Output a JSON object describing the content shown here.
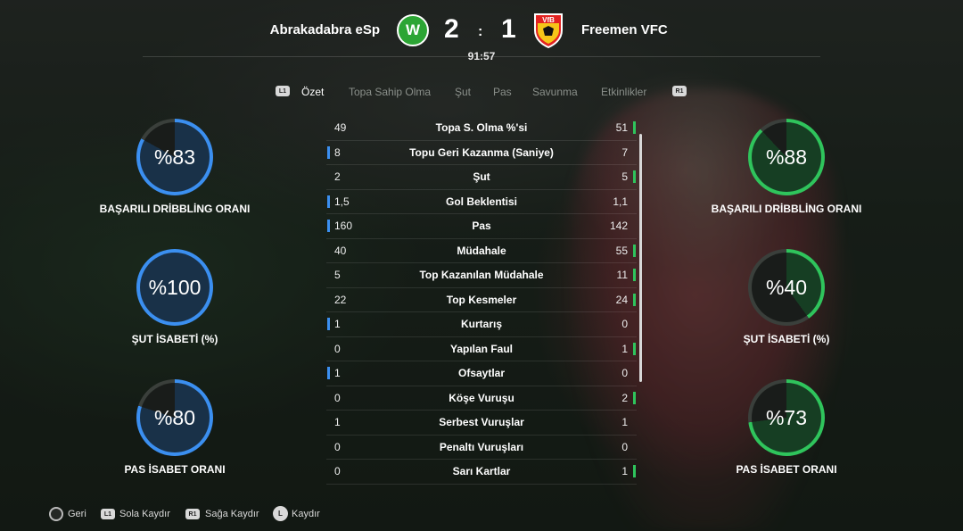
{
  "match": {
    "home_team": "Abrakadabra eSp",
    "away_team": "Freemen VFC",
    "home_score": "2",
    "away_score": "1",
    "separator": ":",
    "clock": "91:57",
    "home_crest_letter": "W",
    "away_crest_text": "VfB"
  },
  "tabs": {
    "left_button": "L1",
    "right_button": "R1",
    "items": [
      "Özet",
      "Topa Sahip Olma",
      "Şut",
      "Pas",
      "Savunma",
      "Etkinlikler"
    ],
    "active_index": 0
  },
  "home_rings": [
    {
      "value": "%83",
      "label": "BAŞARILI DRİBBLİNG ORANI",
      "percent": 83
    },
    {
      "value": "%100",
      "label": "ŞUT İSABETİ (%)",
      "percent": 100
    },
    {
      "value": "%80",
      "label": "PAS İSABET ORANI",
      "percent": 80
    }
  ],
  "away_rings": [
    {
      "value": "%88",
      "label": "BAŞARILI DRİBBLİNG ORANI",
      "percent": 88
    },
    {
      "value": "%40",
      "label": "ŞUT İSABETİ (%)",
      "percent": 40
    },
    {
      "value": "%73",
      "label": "PAS İSABET ORANI",
      "percent": 73
    }
  ],
  "stats": [
    {
      "name": "Topa S. Olma %'si",
      "home": "49",
      "away": "51",
      "leader": "away"
    },
    {
      "name": "Topu Geri Kazanma (Saniye)",
      "home": "8",
      "away": "7",
      "leader": "home"
    },
    {
      "name": "Şut",
      "home": "2",
      "away": "5",
      "leader": "away"
    },
    {
      "name": "Gol Beklentisi",
      "home": "1,5",
      "away": "1,1",
      "leader": "home"
    },
    {
      "name": "Pas",
      "home": "160",
      "away": "142",
      "leader": "home"
    },
    {
      "name": "Müdahale",
      "home": "40",
      "away": "55",
      "leader": "away"
    },
    {
      "name": "Top Kazanılan Müdahale",
      "home": "5",
      "away": "11",
      "leader": "away"
    },
    {
      "name": "Top Kesmeler",
      "home": "22",
      "away": "24",
      "leader": "away"
    },
    {
      "name": "Kurtarış",
      "home": "1",
      "away": "0",
      "leader": "home"
    },
    {
      "name": "Yapılan Faul",
      "home": "0",
      "away": "1",
      "leader": "away"
    },
    {
      "name": "Ofsaytlar",
      "home": "1",
      "away": "0",
      "leader": "home"
    },
    {
      "name": "Köşe Vuruşu",
      "home": "0",
      "away": "2",
      "leader": "away"
    },
    {
      "name": "Serbest Vuruşlar",
      "home": "1",
      "away": "1",
      "leader": "none"
    },
    {
      "name": "Penaltı Vuruşları",
      "home": "0",
      "away": "0",
      "leader": "none"
    },
    {
      "name": "Sarı Kartlar",
      "home": "0",
      "away": "1",
      "leader": "away"
    }
  ],
  "footer": {
    "back_label": "Geri",
    "left_tag": "L1",
    "left_label": "Sola Kaydır",
    "right_tag": "R1",
    "right_label": "Sağa Kaydır",
    "stick_tag": "L",
    "stick_label": "Kaydır"
  },
  "colors": {
    "home_accent": "#3b8ff0",
    "away_accent": "#2fc45c",
    "ring_track": "#3a3f3b",
    "home_ring": "#3b8ff0",
    "away_ring": "#2fc45c"
  }
}
